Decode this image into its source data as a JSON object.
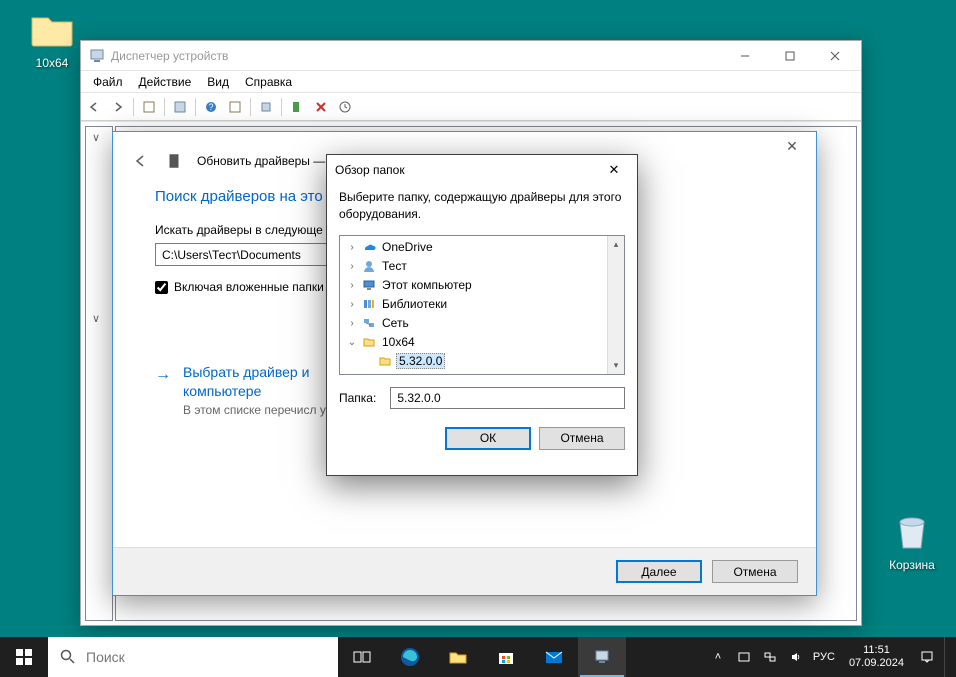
{
  "desktop": {
    "folder_label": "10x64",
    "recyclebin_label": "Корзина"
  },
  "devmgr": {
    "title": "Диспетчер устройств",
    "menu": {
      "file": "Файл",
      "action": "Действие",
      "view": "Вид",
      "help": "Справка"
    }
  },
  "wizard": {
    "title": "Обновить драйверы — Кор",
    "heading": "Поиск драйверов на это",
    "search_label": "Искать драйверы в следующе",
    "path_value": "C:\\Users\\Тест\\Documents",
    "include_sub": "Включая вложенные папки",
    "link_title": "Выбрать драйвер и",
    "link_title2": "компьютере",
    "link_desc": "В этом списке перечисл устройством, а также др",
    "btn_next": "Далее",
    "btn_cancel": "Отмена"
  },
  "browse": {
    "title": "Обзор папок",
    "desc": "Выберите папку, содержащую драйверы для этого оборудования.",
    "tree": {
      "onedrive": "OneDrive",
      "test": "Тест",
      "thispc": "Этот компьютер",
      "libs": "Библиотеки",
      "net": "Сеть",
      "folder": "10x64",
      "sub": "5.32.0.0"
    },
    "folder_label": "Папка:",
    "folder_value": "5.32.0.0",
    "btn_ok": "ОК",
    "btn_cancel": "Отмена"
  },
  "taskbar": {
    "search_placeholder": "Поиск",
    "lang": "РУС",
    "time": "11:51",
    "date": "07.09.2024"
  }
}
